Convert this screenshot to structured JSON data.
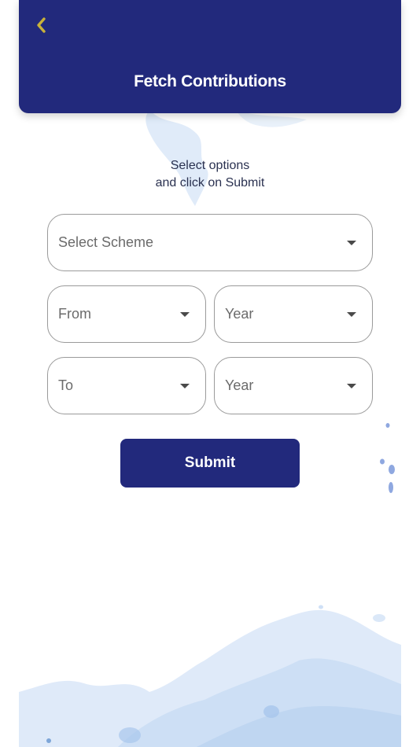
{
  "header": {
    "title": "Fetch Contributions",
    "back_icon": "chevron-left-icon",
    "back_icon_color": "#c9b23a",
    "background_color": "#22297c"
  },
  "instructions": {
    "line1": "Select options",
    "line2": "and click on Submit"
  },
  "form": {
    "scheme": {
      "label": "Select Scheme"
    },
    "from_month": {
      "label": "From"
    },
    "from_year": {
      "label": "Year"
    },
    "to_month": {
      "label": "To"
    },
    "to_year": {
      "label": "Year"
    },
    "dropdown_icon": "caret-down-icon"
  },
  "submit": {
    "label": "Submit",
    "color": "#22297c"
  }
}
